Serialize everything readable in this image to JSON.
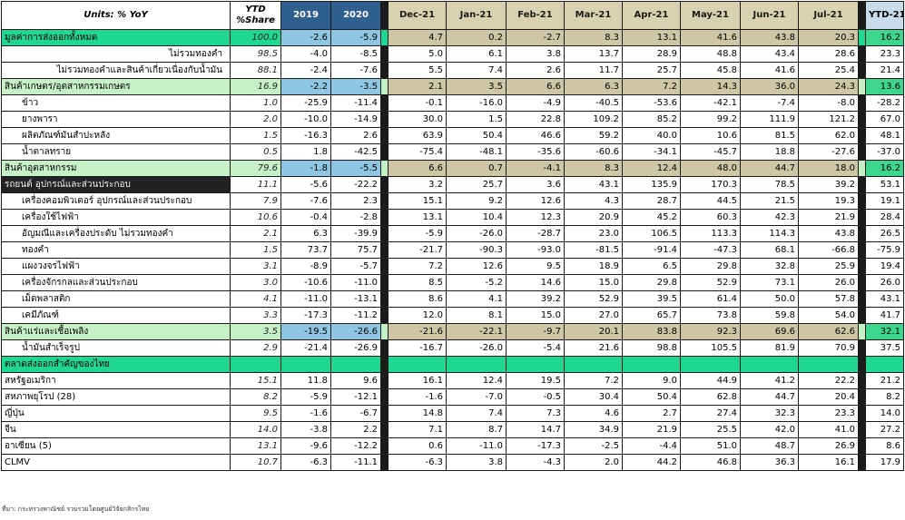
{
  "header": {
    "units": "Units: % YoY",
    "share": "YTD\n%Share",
    "years": [
      "2019",
      "2020"
    ],
    "months": [
      "Dec-21",
      "Jan-21",
      "Feb-21",
      "Mar-21",
      "Apr-21",
      "May-21",
      "Jun-21",
      "Jul-21"
    ],
    "ytd": "YTD-21"
  },
  "rows": [
    {
      "label": "มูลค่าการส่งออกทั้งหมด",
      "share": "100.0",
      "vals": [
        "-2.6",
        "-5.9",
        "4.7",
        "0.2",
        "-2.7",
        "8.3",
        "13.1",
        "41.6",
        "43.8",
        "20.3"
      ],
      "ytd": "16.2",
      "style": "teal",
      "align": "left"
    },
    {
      "label": "ไม่รวมทองคำ",
      "share": "98.5",
      "vals": [
        "-4.0",
        "-8.5",
        "5.0",
        "6.1",
        "3.8",
        "13.7",
        "28.9",
        "48.8",
        "43.4",
        "28.6"
      ],
      "ytd": "23.3",
      "style": "plain",
      "align": "right"
    },
    {
      "label": "ไม่รวมทองคำและสินค้าเกี่ยวเนื่องกับน้ำมัน",
      "share": "88.1",
      "vals": [
        "-2.4",
        "-7.6",
        "5.5",
        "7.4",
        "2.6",
        "11.7",
        "25.7",
        "45.8",
        "41.6",
        "25.4"
      ],
      "ytd": "21.4",
      "style": "plain",
      "align": "right"
    },
    {
      "label": "สินค้าเกษตร/อุตสาหกรรมเกษตร",
      "share": "16.9",
      "vals": [
        "-2.2",
        "-3.5",
        "2.1",
        "3.5",
        "6.6",
        "6.3",
        "7.2",
        "14.3",
        "36.0",
        "24.3"
      ],
      "ytd": "13.6",
      "style": "hl",
      "align": "left"
    },
    {
      "label": "ข้าว",
      "share": "1.0",
      "vals": [
        "-25.9",
        "-11.4",
        "-0.1",
        "-16.0",
        "-4.9",
        "-40.5",
        "-53.6",
        "-42.1",
        "-7.4",
        "-8.0"
      ],
      "ytd": "-28.2",
      "style": "plain",
      "align": "indent"
    },
    {
      "label": "ยางพารา",
      "share": "2.0",
      "vals": [
        "-10.0",
        "-14.9",
        "30.0",
        "1.5",
        "22.8",
        "109.2",
        "85.2",
        "99.2",
        "111.9",
        "121.2"
      ],
      "ytd": "67.0",
      "style": "plain",
      "align": "indent"
    },
    {
      "label": "ผลิตภัณฑ์มันสำปะหลัง",
      "share": "1.5",
      "vals": [
        "-16.3",
        "2.6",
        "63.9",
        "50.4",
        "46.6",
        "59.2",
        "40.0",
        "10.6",
        "81.5",
        "62.0"
      ],
      "ytd": "48.1",
      "style": "plain",
      "align": "indent"
    },
    {
      "label": "น้ำตาลทราย",
      "share": "0.5",
      "vals": [
        "1.8",
        "-42.5",
        "-75.4",
        "-48.1",
        "-35.6",
        "-60.6",
        "-34.1",
        "-45.7",
        "18.8",
        "-27.6"
      ],
      "ytd": "-37.0",
      "style": "plain",
      "align": "indent"
    },
    {
      "label": "สินค้าอุตสาหกรรม",
      "share": "79.6",
      "vals": [
        "-1.8",
        "-5.5",
        "6.6",
        "0.7",
        "-4.1",
        "8.3",
        "12.4",
        "48.0",
        "44.7",
        "18.0"
      ],
      "ytd": "16.2",
      "style": "hl",
      "align": "left"
    },
    {
      "label": "รถยนต์ อุปกรณ์และส่วนประกอบ",
      "share": "11.1",
      "vals": [
        "-5.6",
        "-22.2",
        "3.2",
        "25.7",
        "3.6",
        "43.1",
        "135.9",
        "170.3",
        "78.5",
        "39.2"
      ],
      "ytd": "53.1",
      "style": "dark",
      "align": "left"
    },
    {
      "label": "เครื่องคอมพิวเตอร์ อุปกรณ์และส่วนประกอบ",
      "share": "7.9",
      "vals": [
        "-7.6",
        "2.3",
        "15.1",
        "9.2",
        "12.6",
        "4.3",
        "28.7",
        "44.5",
        "21.5",
        "19.3"
      ],
      "ytd": "19.1",
      "style": "plain",
      "align": "indent"
    },
    {
      "label": "เครื่องใช้ไฟฟ้า",
      "share": "10.6",
      "vals": [
        "-0.4",
        "-2.8",
        "13.1",
        "10.4",
        "12.3",
        "20.9",
        "45.2",
        "60.3",
        "42.3",
        "21.9"
      ],
      "ytd": "28.4",
      "style": "plain",
      "align": "indent"
    },
    {
      "label": "อัญมณีและเครื่องประดับ ไม่รวมทองคำ",
      "share": "2.1",
      "vals": [
        "6.3",
        "-39.9",
        "-5.9",
        "-26.0",
        "-28.7",
        "23.0",
        "106.5",
        "113.3",
        "114.3",
        "43.8"
      ],
      "ytd": "26.5",
      "style": "plain",
      "align": "indent"
    },
    {
      "label": "ทองคำ",
      "share": "1.5",
      "vals": [
        "73.7",
        "75.7",
        "-21.7",
        "-90.3",
        "-93.0",
        "-81.5",
        "-91.4",
        "-47.3",
        "68.1",
        "-66.8"
      ],
      "ytd": "-75.9",
      "style": "plain",
      "align": "indent"
    },
    {
      "label": "แผงวงจรไฟฟ้า",
      "share": "3.1",
      "vals": [
        "-8.9",
        "-5.7",
        "7.2",
        "12.6",
        "9.5",
        "18.9",
        "6.5",
        "29.8",
        "32.8",
        "25.9"
      ],
      "ytd": "19.4",
      "style": "plain",
      "align": "indent"
    },
    {
      "label": "เครื่องจักรกลและส่วนประกอบ",
      "share": "3.0",
      "vals": [
        "-10.6",
        "-11.0",
        "8.5",
        "-5.2",
        "14.6",
        "15.0",
        "29.8",
        "52.9",
        "73.1",
        "26.0"
      ],
      "ytd": "26.0",
      "style": "plain",
      "align": "indent"
    },
    {
      "label": "เม็ดพลาสติก",
      "share": "4.1",
      "vals": [
        "-11.0",
        "-13.1",
        "8.6",
        "4.1",
        "39.2",
        "52.9",
        "39.5",
        "61.4",
        "50.0",
        "57.8"
      ],
      "ytd": "43.1",
      "style": "plain",
      "align": "indent"
    },
    {
      "label": "เคมีภัณฑ์",
      "share": "3.3",
      "vals": [
        "-17.3",
        "-11.2",
        "12.0",
        "8.1",
        "15.0",
        "27.0",
        "65.7",
        "73.8",
        "59.8",
        "54.0"
      ],
      "ytd": "41.7",
      "style": "plain",
      "align": "indent"
    },
    {
      "label": "สินค้าแร่และเชื้อเพลิง",
      "share": "3.5",
      "vals": [
        "-19.5",
        "-26.6",
        "-21.6",
        "-22.1",
        "-9.7",
        "20.1",
        "83.8",
        "92.3",
        "69.6",
        "62.6"
      ],
      "ytd": "32.1",
      "style": "hl",
      "align": "left"
    },
    {
      "label": "น้ำมันสำเร็จรูป",
      "share": "2.9",
      "vals": [
        "-21.4",
        "-26.9",
        "-16.7",
        "-26.0",
        "-5.4",
        "21.6",
        "98.8",
        "105.5",
        "81.9",
        "70.9"
      ],
      "ytd": "37.5",
      "style": "plain",
      "align": "indent"
    },
    {
      "label": "ตลาดส่งออกสำคัญของไทย",
      "share": "",
      "vals": [
        "",
        "",
        "",
        "",
        "",
        "",
        "",
        "",
        "",
        ""
      ],
      "ytd": "",
      "style": "section",
      "align": "left"
    },
    {
      "label": "สหรัฐอเมริกา",
      "share": "15.1",
      "vals": [
        "11.8",
        "9.6",
        "16.1",
        "12.4",
        "19.5",
        "7.2",
        "9.0",
        "44.9",
        "41.2",
        "22.2"
      ],
      "ytd": "21.2",
      "style": "plain",
      "align": "left"
    },
    {
      "label": "สหภาพยุโรป (28)",
      "share": "8.2",
      "vals": [
        "-5.9",
        "-12.1",
        "-1.6",
        "-7.0",
        "-0.5",
        "30.4",
        "50.4",
        "62.8",
        "44.7",
        "20.4"
      ],
      "ytd": "8.2",
      "style": "plain",
      "align": "left"
    },
    {
      "label": "ญี่ปุ่น",
      "share": "9.5",
      "vals": [
        "-1.6",
        "-6.7",
        "14.8",
        "7.4",
        "7.3",
        "4.6",
        "2.7",
        "27.4",
        "32.3",
        "23.3"
      ],
      "ytd": "14.0",
      "style": "plain",
      "align": "left"
    },
    {
      "label": "จีน",
      "share": "14.0",
      "vals": [
        "-3.8",
        "2.2",
        "7.1",
        "8.7",
        "14.7",
        "34.9",
        "21.9",
        "25.5",
        "42.0",
        "41.0"
      ],
      "ytd": "27.2",
      "style": "plain",
      "align": "left"
    },
    {
      "label": "อาเซียน (5)",
      "share": "13.1",
      "vals": [
        "-9.6",
        "-12.2",
        "0.6",
        "-11.0",
        "-17.3",
        "-2.5",
        "-4.4",
        "51.0",
        "48.7",
        "26.9"
      ],
      "ytd": "8.6",
      "style": "plain",
      "align": "left"
    },
    {
      "label": "CLMV",
      "share": "10.7",
      "vals": [
        "-6.3",
        "-11.1",
        "-6.3",
        "3.8",
        "-4.3",
        "2.0",
        "44.2",
        "46.8",
        "36.3",
        "16.1"
      ],
      "ytd": "17.9",
      "style": "plain",
      "align": "left"
    }
  ],
  "footnote": "ที่มา: กระทรวงพาณิชย์ รวบรวมโดยศูนย์วิจัยกสิกรไทย",
  "colors": {
    "teal": "#1fd693",
    "green_light": "#c6f0c6",
    "year_blue": "#2f5f8f",
    "month_tan": "#d9d2b0",
    "ytd_green": "#3dd68c"
  }
}
